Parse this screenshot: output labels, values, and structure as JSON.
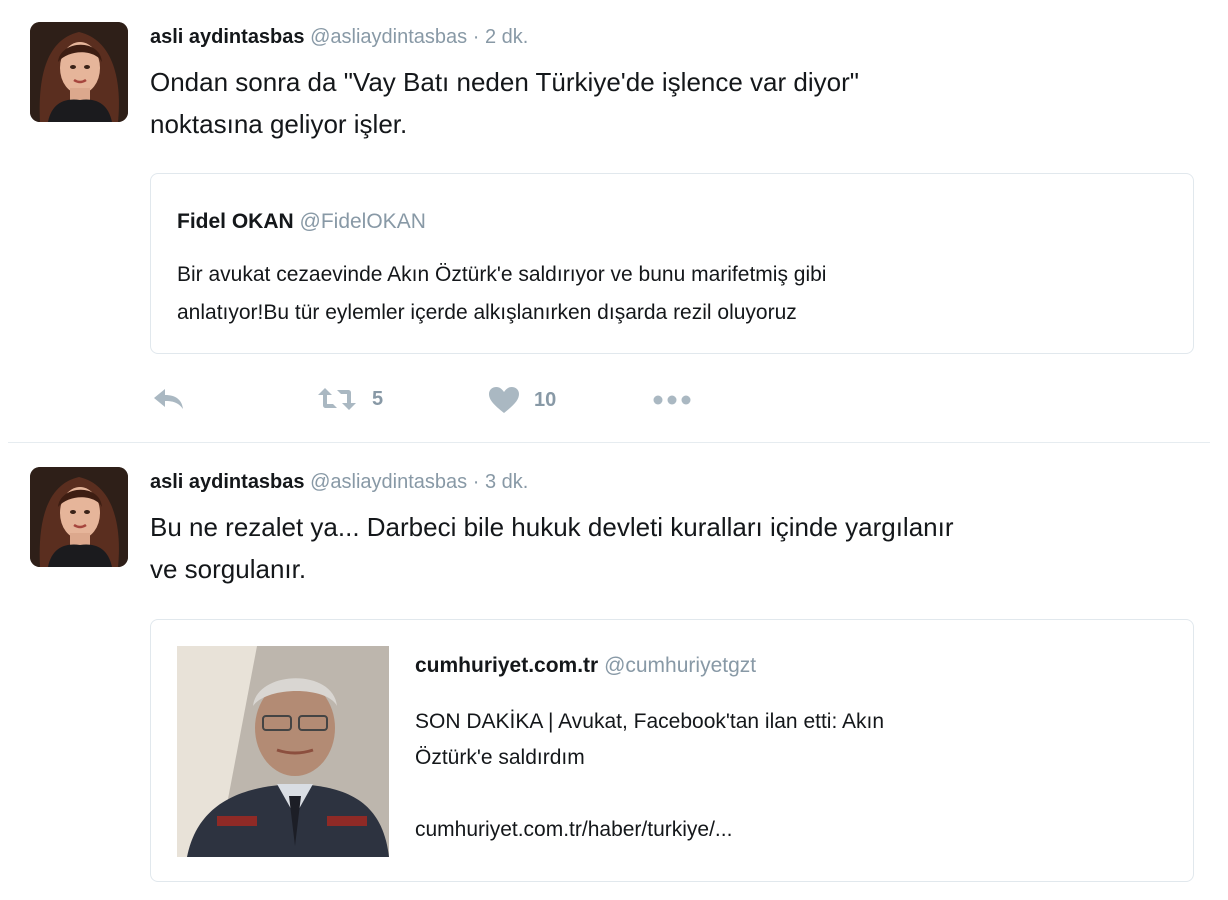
{
  "tweets": [
    {
      "author_name": "asli aydintasbas",
      "author_handle": "@asliaydintasbas",
      "separator": "·",
      "time": "2 dk.",
      "text_line1": "Ondan sonra da \"Vay Batı neden Türkiye'de işlence var diyor\"",
      "text_line2": "noktasına geliyor işler.",
      "quote": {
        "name": "Fidel OKAN",
        "handle": "@FidelOKAN",
        "text_line1": "Bir avukat cezaevinde Akın Öztürk'e saldırıyor ve bunu marifetmiş gibi",
        "text_line2": "anlatıyor!Bu tür eylemler içerde alkışlanırken dışarda rezil oluyoruz"
      },
      "actions": {
        "retweet_count": "5",
        "like_count": "10"
      }
    },
    {
      "author_name": "asli aydintasbas",
      "author_handle": "@asliaydintasbas",
      "separator": "·",
      "time": "3 dk.",
      "text_line1": "Bu ne rezalet ya... Darbeci bile hukuk devleti kuralları içinde yargılanır",
      "text_line2": "ve sorgulanır.",
      "card": {
        "name": "cumhuriyet.com.tr",
        "handle": "@cumhuriyetgzt",
        "desc_line1": "SON DAKİKA | Avukat, Facebook'tan ilan etti: Akın",
        "desc_line2": "Öztürk'e saldırdım",
        "link": "cumhuriyet.com.tr/haber/turkiye/..."
      }
    }
  ],
  "icons": {
    "reply": "reply-icon",
    "retweet": "retweet-icon",
    "like": "heart-icon",
    "more": "more-dots-icon"
  },
  "colors": {
    "muted": "#8899a6",
    "text": "#14171a",
    "border": "#e1e8ed",
    "action_icon": "#aab8c2"
  }
}
